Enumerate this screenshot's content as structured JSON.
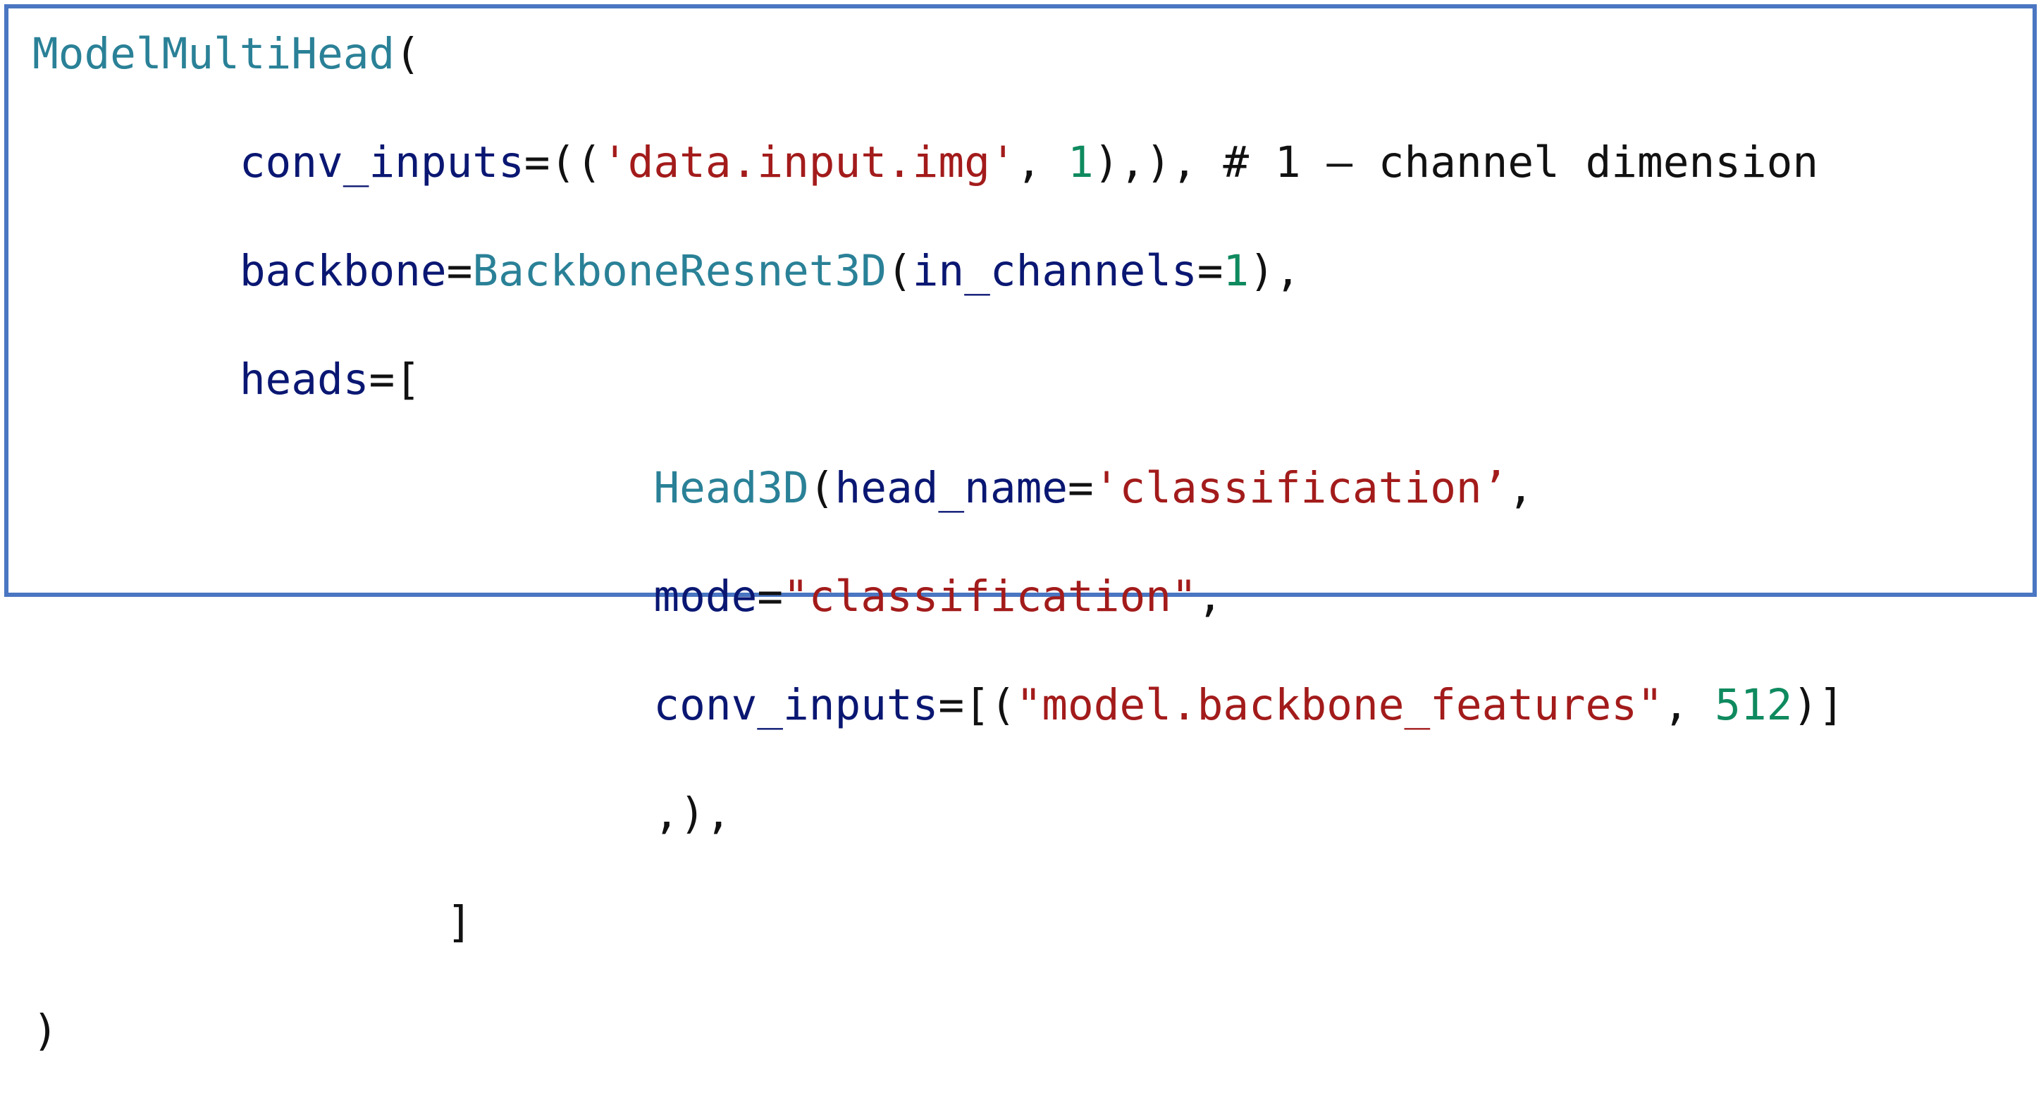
{
  "colors": {
    "frame_border": "#4a76c2",
    "class_name": "#2a8197",
    "parameter": "#0a1772",
    "string": "#a31b1b",
    "number": "#0f8a5f",
    "punctuation": "#111111"
  },
  "code": {
    "lines": [
      [
        {
          "t": "class",
          "v": "ModelMultiHead"
        },
        {
          "t": "punct",
          "v": "("
        }
      ],
      [
        {
          "t": "punct",
          "v": "        "
        },
        {
          "t": "param",
          "v": "conv_inputs"
        },
        {
          "t": "punct",
          "v": "=(("
        },
        {
          "t": "string",
          "v": "'data.input.img'"
        },
        {
          "t": "punct",
          "v": ", "
        },
        {
          "t": "number",
          "v": "1"
        },
        {
          "t": "punct",
          "v": "),), "
        },
        {
          "t": "comment",
          "v": "# 1 – channel dimension"
        }
      ],
      [
        {
          "t": "punct",
          "v": "        "
        },
        {
          "t": "param",
          "v": "backbone"
        },
        {
          "t": "punct",
          "v": "="
        },
        {
          "t": "class",
          "v": "BackboneResnet3D"
        },
        {
          "t": "punct",
          "v": "("
        },
        {
          "t": "param",
          "v": "in_channels"
        },
        {
          "t": "punct",
          "v": "="
        },
        {
          "t": "number",
          "v": "1"
        },
        {
          "t": "punct",
          "v": "),"
        }
      ],
      [
        {
          "t": "punct",
          "v": "        "
        },
        {
          "t": "param",
          "v": "heads"
        },
        {
          "t": "punct",
          "v": "=["
        }
      ],
      [
        {
          "t": "punct",
          "v": "                        "
        },
        {
          "t": "class",
          "v": "Head3D"
        },
        {
          "t": "punct",
          "v": "("
        },
        {
          "t": "param",
          "v": "head_name"
        },
        {
          "t": "punct",
          "v": "="
        },
        {
          "t": "string",
          "v": "'classification’"
        },
        {
          "t": "punct",
          "v": ","
        }
      ],
      [
        {
          "t": "punct",
          "v": "                        "
        },
        {
          "t": "param",
          "v": "mode"
        },
        {
          "t": "punct",
          "v": "="
        },
        {
          "t": "string",
          "v": "\"classification\""
        },
        {
          "t": "punct",
          "v": ","
        }
      ],
      [
        {
          "t": "punct",
          "v": "                        "
        },
        {
          "t": "param",
          "v": "conv_inputs"
        },
        {
          "t": "punct",
          "v": "=[("
        },
        {
          "t": "string",
          "v": "\"model.backbone_features\""
        },
        {
          "t": "punct",
          "v": ", "
        },
        {
          "t": "number",
          "v": "512"
        },
        {
          "t": "punct",
          "v": ")]"
        }
      ],
      [
        {
          "t": "punct",
          "v": "                        "
        },
        {
          "t": "punct",
          "v": ",),"
        }
      ],
      [
        {
          "t": "punct",
          "v": "                "
        },
        {
          "t": "punct",
          "v": "]"
        }
      ],
      [
        {
          "t": "punct",
          "v": ")"
        }
      ]
    ]
  }
}
